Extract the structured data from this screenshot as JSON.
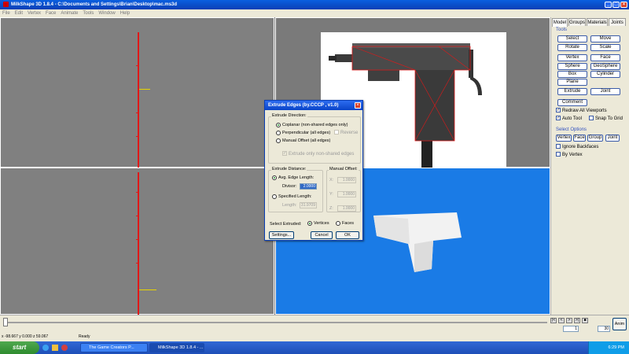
{
  "window": {
    "title": "MilkShape 3D 1.8.4 - C:\\Documents and Settings\\Brian\\Desktop\\mac.ms3d"
  },
  "menu": [
    "File",
    "Edit",
    "Vertex",
    "Face",
    "Animate",
    "Tools",
    "Window",
    "Help"
  ],
  "panel": {
    "tabs": [
      "Model",
      "Groups",
      "Materials",
      "Joints"
    ],
    "tools_label": "Tools",
    "tools": [
      "Select",
      "Move",
      "Rotate",
      "Scale",
      "Vertex",
      "Face",
      "Sphere",
      "GeoSphere",
      "Box",
      "Cylinder",
      "Plane",
      "Extrude",
      "Joint",
      "Comment"
    ],
    "checks": {
      "redraw_all": "Redraw All Viewports",
      "auto_tool": "Auto Tool",
      "snap_grid": "Snap To Grid"
    },
    "select_options_label": "Select Options",
    "select_modes": [
      "Vertex",
      "Face",
      "Group",
      "Joint"
    ],
    "ignore_backfaces": "Ignore Backfaces",
    "by_vertex": "By Vertex"
  },
  "dialog": {
    "title": "Extrude Edges (by.CCCP , v1.0)",
    "direction_legend": "Extrude Direction:",
    "coplanar": "Coplanar (non-shared edges only)",
    "perpendicular": "Perpendicular (all edges)",
    "reverse": "Reverse",
    "manual_offset": "Manual Offset (all edges)",
    "extrude_only_nonshared": "Extrude only non-shared edges",
    "distance_legend": "Extrude Distance:",
    "avg_edge_length": "Avg. Edge Length:",
    "divisor_label": "Divisor:",
    "divisor_value": "2.0000",
    "specified_length": "Specified Length:",
    "length_label": "Length:",
    "length_value": "31.9709",
    "manual_offset_legend": "Manual Offset:",
    "x_label": "X:",
    "x_value": "1.0000",
    "y_label": "Y:",
    "y_value": "1.0000",
    "z_label": "Z:",
    "z_value": "1.0000",
    "select_extruded": "Select Extruded:",
    "vertices": "Vertices",
    "faces": "Faces",
    "settings_btn": "Settings...",
    "cancel_btn": "Cancel",
    "ok_btn": "OK"
  },
  "timeline": {
    "anim_btn": "Anim",
    "frame_value": "1",
    "total_frames": "30"
  },
  "status": {
    "coords": "x -98.667 y 0.000 z 59.067",
    "state": "Ready"
  },
  "taskbar": {
    "start": "start",
    "tasks": [
      "The Game Creators P...",
      "MilkShape 3D 1.8.4 - ..."
    ],
    "clock": "6:29 PM"
  }
}
